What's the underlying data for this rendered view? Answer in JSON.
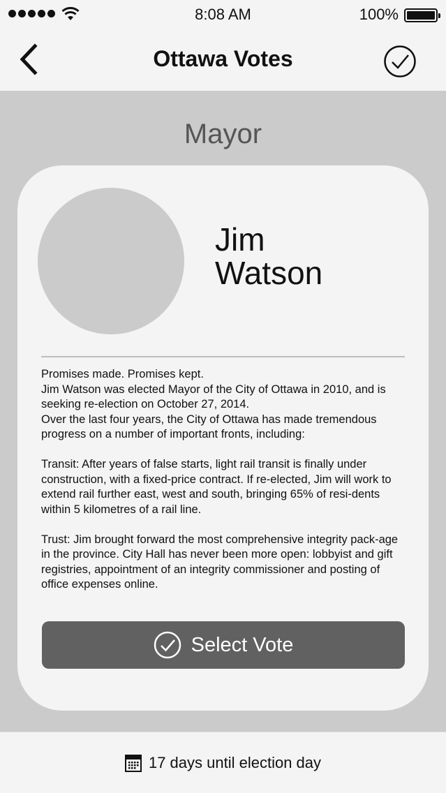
{
  "status_bar": {
    "time": "8:08 AM",
    "battery_percent": "100%",
    "signal_bars": 5,
    "icons": [
      "signal-icon",
      "wifi-icon",
      "battery-icon"
    ]
  },
  "nav": {
    "title": "Ottawa Votes",
    "back_icon": "chevron-left-icon",
    "confirm_icon": "check-circle-icon"
  },
  "section": {
    "title": "Mayor"
  },
  "candidate": {
    "first_name": "Jim",
    "last_name": "Watson",
    "bio": {
      "heading": "Promises made. Promises kept.",
      "intro": "Jim Watson was elected Mayor of the City of Ottawa in 2010, and is seeking re-election on October 27, 2014.",
      "progress": "Over the last four years, the City of Ottawa has made tremendous progress on a number of important fronts, including:",
      "transit_label": "Transit:",
      "transit_text": " After years of false starts, light rail transit is finally under construction, with a fixed-price contract. If re-elected, Jim will work to extend rail further east, west and south, bringing 65% of resi-dents within 5 kilometres of a rail line.",
      "trust_label": "Trust:",
      "trust_text": " Jim brought forward the most comprehensive integrity pack-age in the province. City Hall has never been more open: lobbyist and gift registries, appointment of an integrity commissioner and posting of office expenses online."
    }
  },
  "actions": {
    "select_vote_label": "Select Vote",
    "select_vote_icon": "check-circle-icon"
  },
  "footer": {
    "countdown_text": "17 days until election day",
    "calendar_icon": "calendar-icon"
  },
  "colors": {
    "bar_background": "#f4f4f4",
    "page_background": "#cbcbcb",
    "button": "#616161",
    "section_title": "#555555"
  }
}
